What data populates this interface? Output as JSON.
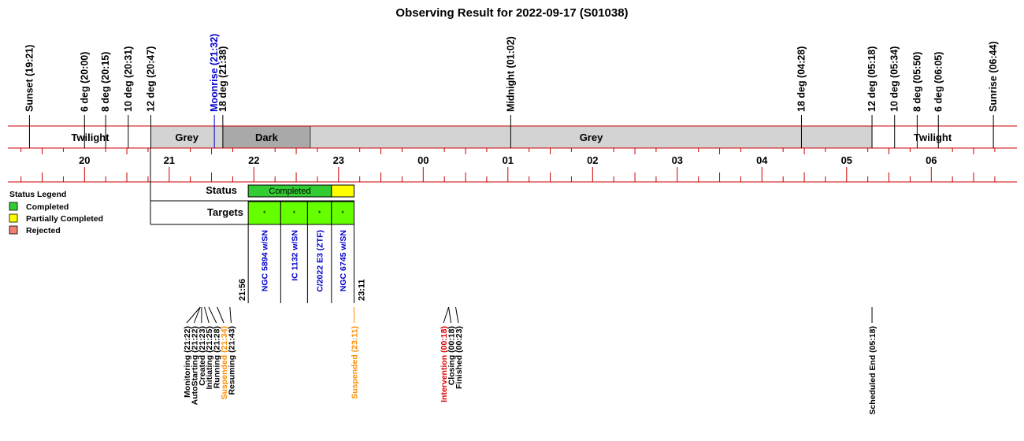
{
  "title": "Observing Result for 2022-09-17 (S01038)",
  "colors": {
    "axis_red": "#cc0000",
    "twilight": "#ffffff",
    "grey": "#d3d3d3",
    "dark": "#a9a9a9",
    "completed": "#33cc33",
    "partial": "#ffff00",
    "rejected": "#f08070",
    "target_fill": "#66ff00",
    "moon_label": "#0000cc",
    "suspended": "#ff8c00",
    "intervention": "#dd0000"
  },
  "chart_data": {
    "type": "timeline",
    "title": "Observing Result for 2022-09-17 (S01038)",
    "time_range": [
      "19:00",
      "07:00"
    ],
    "hour_ticks": [
      "20",
      "21",
      "22",
      "23",
      "00",
      "01",
      "02",
      "03",
      "04",
      "05",
      "06"
    ],
    "sky_events": [
      {
        "label": "Sunset (19:21)",
        "time": "19:21",
        "color": "black"
      },
      {
        "label": "6 deg (20:00)",
        "time": "20:00",
        "color": "black"
      },
      {
        "label": "8 deg (20:15)",
        "time": "20:15",
        "color": "black"
      },
      {
        "label": "10 deg (20:31)",
        "time": "20:31",
        "color": "black"
      },
      {
        "label": "12 deg (20:47)",
        "time": "20:47",
        "color": "black"
      },
      {
        "label": "Moonrise (21:32)",
        "time": "21:32",
        "color": "blue"
      },
      {
        "label": "18 deg (21:38)",
        "time": "21:38",
        "color": "black"
      },
      {
        "label": "Midnight (01:02)",
        "time": "01:02",
        "color": "black"
      },
      {
        "label": "18 deg (04:28)",
        "time": "04:28",
        "color": "black"
      },
      {
        "label": "12 deg (05:18)",
        "time": "05:18",
        "color": "black"
      },
      {
        "label": "10 deg (05:34)",
        "time": "05:34",
        "color": "black"
      },
      {
        "label": "8 deg (05:50)",
        "time": "05:50",
        "color": "black"
      },
      {
        "label": "6 deg (06:05)",
        "time": "06:05",
        "color": "black"
      },
      {
        "label": "Sunrise (06:44)",
        "time": "06:44",
        "color": "black"
      }
    ],
    "sky_bands": [
      {
        "label": "Twilight",
        "start": "19:21",
        "end": "20:47",
        "kind": "twilight"
      },
      {
        "label": "Grey",
        "start": "20:47",
        "end": "21:38",
        "kind": "grey"
      },
      {
        "label": "Dark",
        "start": "21:38",
        "end": "22:40",
        "kind": "dark"
      },
      {
        "label": "Grey",
        "start": "22:40",
        "end": "05:18",
        "kind": "grey"
      },
      {
        "label": "Twilight",
        "start": "05:18",
        "end": "06:44",
        "kind": "twilight"
      }
    ],
    "status_label": "Status",
    "targets_label": "Targets",
    "status_blocks": [
      {
        "label": "Completed",
        "start": "21:56",
        "end": "22:55",
        "status": "completed"
      },
      {
        "label": "",
        "start": "22:55",
        "end": "23:11",
        "status": "partial"
      }
    ],
    "targets": [
      {
        "name": "NGC 5894 w/SN",
        "start": "21:56",
        "end": "22:19",
        "mark": "*"
      },
      {
        "name": "IC 1132 w/SN",
        "start": "22:19",
        "end": "22:38",
        "mark": "*"
      },
      {
        "name": "C/2022 E3 (ZTF)",
        "start": "22:38",
        "end": "22:55",
        "mark": "*"
      },
      {
        "name": "NGC 6745 w/SN",
        "start": "22:55",
        "end": "23:11",
        "mark": "*"
      }
    ],
    "obs_time_labels": [
      {
        "label": "21:56",
        "time": "21:56"
      },
      {
        "label": "23:11",
        "time": "23:11"
      }
    ],
    "legend_title": "Status Legend",
    "legend": [
      {
        "label": "Completed",
        "status": "completed"
      },
      {
        "label": "Partially Completed",
        "status": "partial"
      },
      {
        "label": "Rejected",
        "status": "rejected"
      }
    ],
    "log_events": [
      {
        "label": "Monitoring (21:22)",
        "time": "21:22",
        "color": "black"
      },
      {
        "label": "AutoStarting (21:22)",
        "time": "21:22",
        "color": "black"
      },
      {
        "label": "Created (21:23)",
        "time": "21:23",
        "color": "black"
      },
      {
        "label": "Initiating (21:25)",
        "time": "21:25",
        "color": "black"
      },
      {
        "label": "Running (21:28)",
        "time": "21:28",
        "color": "black"
      },
      {
        "label": "Suspended (21:34)",
        "time": "21:34",
        "color": "orange"
      },
      {
        "label": "Resuming (21:43)",
        "time": "21:43",
        "color": "black"
      },
      {
        "label": "Suspended (23:11)",
        "time": "23:11",
        "color": "orange"
      },
      {
        "label": "Intervention (00:18)",
        "time": "00:18",
        "color": "red"
      },
      {
        "label": "Closing (00:18)",
        "time": "00:18",
        "color": "black"
      },
      {
        "label": "Finished (00:23)",
        "time": "00:23",
        "color": "black"
      },
      {
        "label": "Scheduled End (05:18)",
        "time": "05:18",
        "color": "black"
      }
    ]
  }
}
